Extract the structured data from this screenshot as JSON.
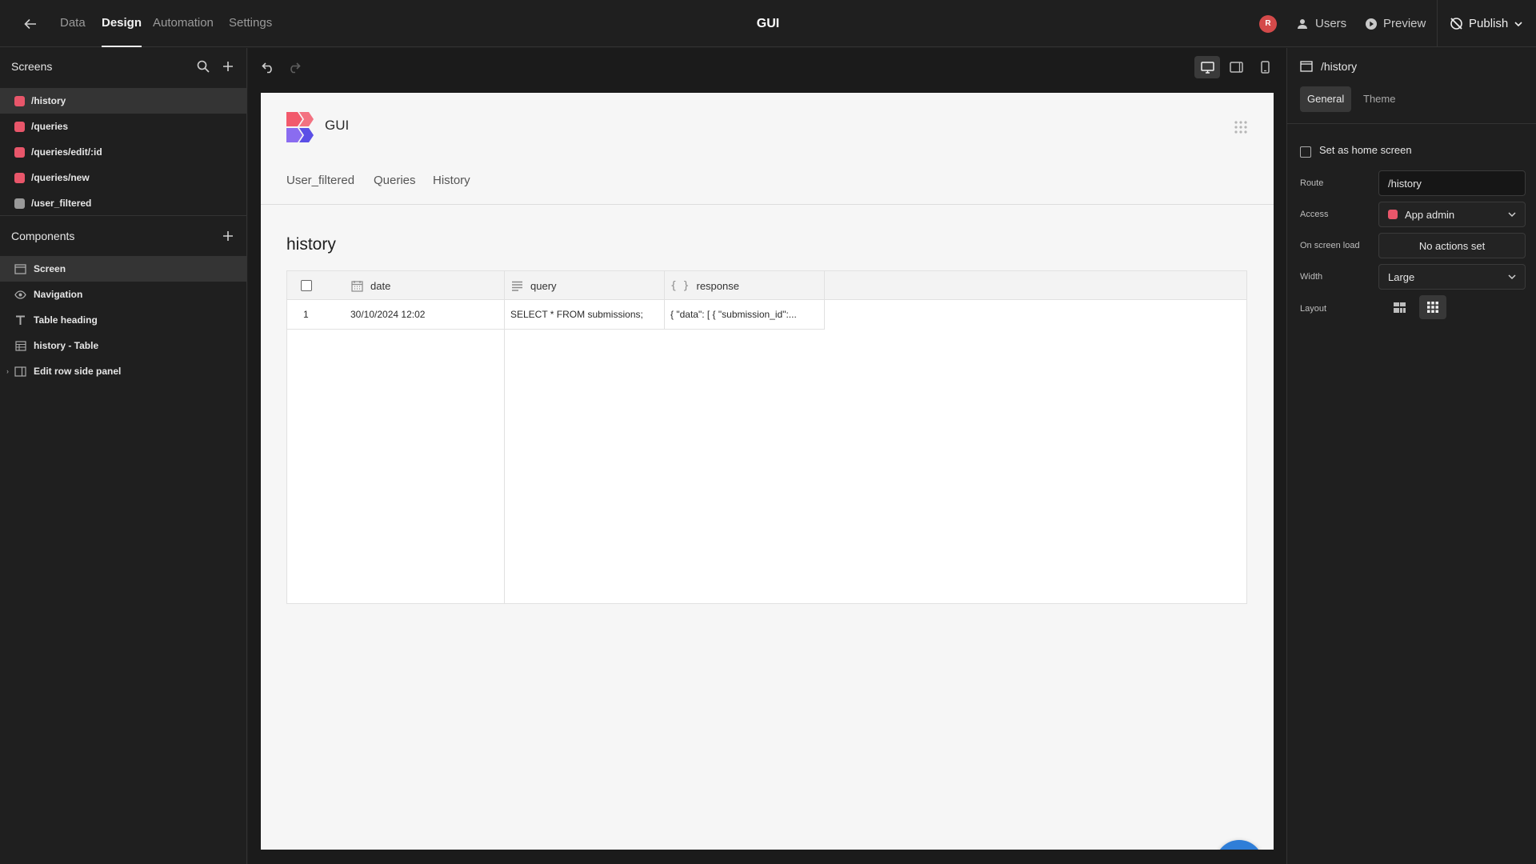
{
  "topbar": {
    "tabs": [
      {
        "label": "Data"
      },
      {
        "label": "Design"
      },
      {
        "label": "Automation"
      },
      {
        "label": "Settings"
      }
    ],
    "app_title": "GUI",
    "avatar_initial": "R",
    "users_label": "Users",
    "preview_label": "Preview",
    "publish_label": "Publish"
  },
  "screens_panel": {
    "title": "Screens",
    "items": [
      {
        "label": "/history",
        "color": "#e8566a",
        "active": true
      },
      {
        "label": "/queries",
        "color": "#e8566a",
        "active": false
      },
      {
        "label": "/queries/edit/:id",
        "color": "#e8566a",
        "active": false
      },
      {
        "label": "/queries/new",
        "color": "#e8566a",
        "active": false
      },
      {
        "label": "/user_filtered",
        "color": "#9a9a9a",
        "active": false
      }
    ]
  },
  "components_panel": {
    "title": "Components",
    "items": [
      {
        "label": "Screen",
        "icon": "screen-icon",
        "active": true
      },
      {
        "label": "Navigation",
        "icon": "eye-icon",
        "active": false
      },
      {
        "label": "Table heading",
        "icon": "text-icon",
        "active": false
      },
      {
        "label": "history - Table",
        "icon": "table-icon",
        "active": false
      },
      {
        "label": "Edit row side panel",
        "icon": "side-panel-icon",
        "active": false
      }
    ]
  },
  "preview": {
    "app_name": "GUI",
    "nav_links": [
      "User_filtered",
      "Queries",
      "History"
    ],
    "heading": "history",
    "table": {
      "columns": [
        {
          "label": "date",
          "icon": "calendar-icon"
        },
        {
          "label": "query",
          "icon": "text-lines-icon"
        },
        {
          "label": "response",
          "icon": "braces-icon"
        }
      ],
      "rows": [
        {
          "index": "1",
          "date": "30/10/2024 12:02",
          "query": "SELECT * FROM submissions;",
          "response": "{ \"data\": [ { \"submission_id\":..."
        }
      ]
    },
    "fab_icon": "plus-icon"
  },
  "right_panel": {
    "title": "/history",
    "tabs": [
      "General",
      "Theme"
    ],
    "home_screen_label": "Set as home screen",
    "route_label": "Route",
    "route_value": "/history",
    "access_label": "Access",
    "access_value": "App admin",
    "access_color": "#e8566a",
    "onload_label": "On screen load",
    "onload_value": "No actions set",
    "width_label": "Width",
    "width_value": "Large",
    "layout_label": "Layout"
  },
  "colors": {
    "accent": "#2f7ed8",
    "screen_dot": "#e8566a"
  }
}
